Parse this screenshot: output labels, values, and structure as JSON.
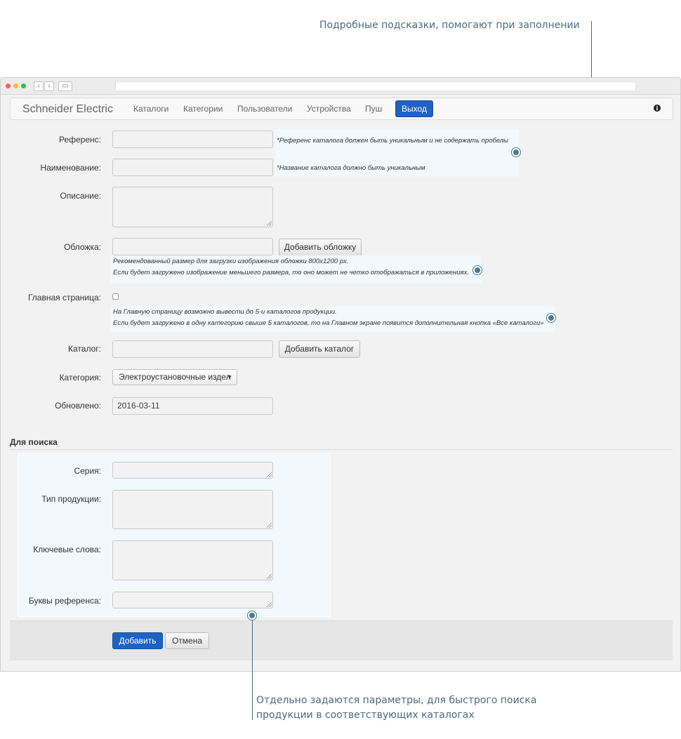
{
  "annotations": {
    "hints_callout": "Подробные подсказки, помогают при заполнении",
    "search_callout_line1": "Отдельно задаются параметры, для быстрого поиска",
    "search_callout_line2": "продукции в соответствующих каталогах"
  },
  "navbar": {
    "brand": "Schneider Electric",
    "links": [
      "Каталоги",
      "Категории",
      "Пользователи",
      "Устройства",
      "Пуш"
    ],
    "logout": "Выход",
    "info_icon": "i"
  },
  "form": {
    "reference_label": "Референс:",
    "reference_hint": "*Референс каталога должен быть уникальным и не содержать пробелы",
    "name_label": "Наименование:",
    "name_hint": "*Название каталога должно быть уникальным",
    "description_label": "Описание:",
    "cover_label": "Обложка:",
    "cover_button": "Добавить обложку",
    "cover_hint_line1": "Рекомендованный размер для загрузки изображения обложки 800x1200 px.",
    "cover_hint_line2": "Если будет загружено изображение меньшего размера, то оно может не четко отображаться в приложениях.",
    "homepage_label": "Главная страница:",
    "homepage_hint_line1": "На Главную страницу возможно вывести до 5-и каталогов продукции.",
    "homepage_hint_line2": "Если будет загружено в одну категорию свыше 5 каталогов, то на Главном экране появится дополнительная кнопка «Все каталоги»",
    "catalog_label": "Каталог:",
    "catalog_button": "Добавить каталог",
    "category_label": "Категория:",
    "category_value": "Электроустановочные издел",
    "updated_label": "Обновлено:",
    "updated_value": "2016-03-11"
  },
  "search": {
    "title": "Для поиска",
    "series_label": "Серия:",
    "product_type_label": "Тип продукции:",
    "keywords_label": "Ключевые слова:",
    "ref_letters_label": "Буквы референса:"
  },
  "footer": {
    "add_button": "Добавить",
    "cancel_button": "Отмена"
  },
  "colors": {
    "accent": "#1f62c1",
    "annotation": "#4e6b7e",
    "hint_bg": "#f2f8fc"
  }
}
